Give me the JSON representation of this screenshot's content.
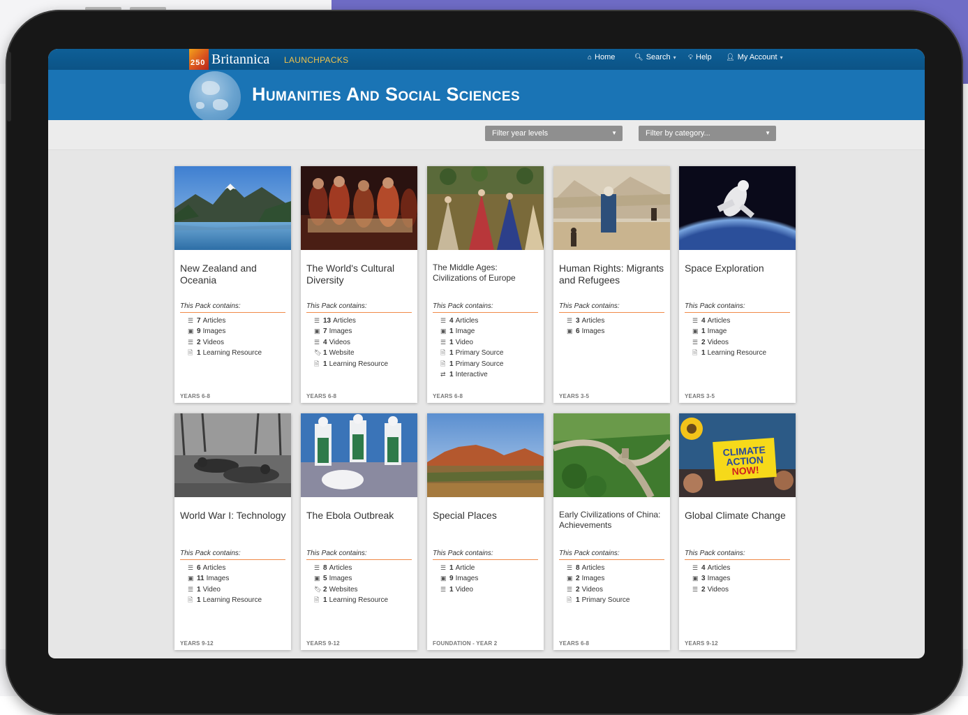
{
  "header": {
    "logo_number": "250",
    "brand": "Britannica",
    "brand_sub": "LAUNCHPACKS",
    "nav": [
      {
        "icon": "home-icon",
        "glyph": "⌂",
        "label": "Home",
        "caret": false
      },
      {
        "icon": "search-icon",
        "glyph": "🔍︎",
        "label": "Search",
        "caret": true
      },
      {
        "icon": "help-icon",
        "glyph": "💡︎",
        "label": "Help",
        "caret": false
      },
      {
        "icon": "user-icon",
        "glyph": "👤︎",
        "label": "My Account",
        "caret": true
      }
    ]
  },
  "banner": {
    "title": "Humanities And Social Sciences"
  },
  "filters": {
    "year_levels": "Filter year levels",
    "category": "Filter by category..."
  },
  "pack_contains_label": "This Pack contains:",
  "cards": [
    {
      "title": "New Zealand and Oceania",
      "years": "YEARS 6-8",
      "items": [
        {
          "type": "articles",
          "count": "7",
          "label": "Articles"
        },
        {
          "type": "images",
          "count": "9",
          "label": "Images"
        },
        {
          "type": "videos",
          "count": "2",
          "label": "Videos"
        },
        {
          "type": "learning",
          "count": "1",
          "label": "Learning Resource"
        }
      ]
    },
    {
      "title": "The World's Cultural Diversity",
      "years": "YEARS 6-8",
      "items": [
        {
          "type": "articles",
          "count": "13",
          "label": "Articles"
        },
        {
          "type": "images",
          "count": "7",
          "label": "Images"
        },
        {
          "type": "videos",
          "count": "4",
          "label": "Videos"
        },
        {
          "type": "website",
          "count": "1",
          "label": "Website"
        },
        {
          "type": "learning",
          "count": "1",
          "label": "Learning Resource"
        }
      ]
    },
    {
      "title": "The Middle Ages: Civilizations of Europe",
      "years": "YEARS 6-8",
      "small": true,
      "items": [
        {
          "type": "articles",
          "count": "4",
          "label": "Articles"
        },
        {
          "type": "images",
          "count": "1",
          "label": "Image"
        },
        {
          "type": "videos",
          "count": "1",
          "label": "Video"
        },
        {
          "type": "primary",
          "count": "1",
          "label": "Primary Source"
        },
        {
          "type": "primary",
          "count": "1",
          "label": "Primary Source"
        },
        {
          "type": "interactive",
          "count": "1",
          "label": "Interactive"
        }
      ]
    },
    {
      "title": "Human Rights: Migrants and Refugees",
      "years": "YEARS 3-5",
      "items": [
        {
          "type": "articles",
          "count": "3",
          "label": "Articles"
        },
        {
          "type": "images",
          "count": "6",
          "label": "Images"
        }
      ]
    },
    {
      "title": "Space Exploration",
      "years": "YEARS 3-5",
      "items": [
        {
          "type": "articles",
          "count": "4",
          "label": "Articles"
        },
        {
          "type": "images",
          "count": "1",
          "label": "Image"
        },
        {
          "type": "videos",
          "count": "2",
          "label": "Videos"
        },
        {
          "type": "learning",
          "count": "1",
          "label": "Learning Resource"
        }
      ]
    },
    {
      "title": "World War I: Technology",
      "years": "YEARS 9-12",
      "items": [
        {
          "type": "articles",
          "count": "6",
          "label": "Articles"
        },
        {
          "type": "images",
          "count": "11",
          "label": "Images"
        },
        {
          "type": "videos",
          "count": "1",
          "label": "Video"
        },
        {
          "type": "learning",
          "count": "1",
          "label": "Learning Resource"
        }
      ]
    },
    {
      "title": "The Ebola Outbreak",
      "years": "YEARS 9-12",
      "items": [
        {
          "type": "articles",
          "count": "8",
          "label": "Articles"
        },
        {
          "type": "images",
          "count": "5",
          "label": "Images"
        },
        {
          "type": "website",
          "count": "2",
          "label": "Websites"
        },
        {
          "type": "learning",
          "count": "1",
          "label": "Learning Resource"
        }
      ]
    },
    {
      "title": "Special Places",
      "years": "FOUNDATION - YEAR 2",
      "items": [
        {
          "type": "articles",
          "count": "1",
          "label": "Article"
        },
        {
          "type": "images",
          "count": "9",
          "label": "Images"
        },
        {
          "type": "videos",
          "count": "1",
          "label": "Video"
        }
      ]
    },
    {
      "title": "Early Civilizations of China: Achievements",
      "years": "YEARS 6-8",
      "small": true,
      "items": [
        {
          "type": "articles",
          "count": "8",
          "label": "Articles"
        },
        {
          "type": "images",
          "count": "2",
          "label": "Images"
        },
        {
          "type": "videos",
          "count": "2",
          "label": "Videos"
        },
        {
          "type": "primary",
          "count": "1",
          "label": "Primary Source"
        }
      ]
    },
    {
      "title": "Global Climate Change",
      "years": "YEARS 9-12",
      "items": [
        {
          "type": "articles",
          "count": "4",
          "label": "Articles"
        },
        {
          "type": "images",
          "count": "3",
          "label": "Images"
        },
        {
          "type": "videos",
          "count": "2",
          "label": "Videos"
        }
      ]
    }
  ],
  "climate_sign": [
    "CLIMATE",
    "ACTION",
    "NOW!"
  ],
  "colors": {
    "topbar": "#0b5386",
    "banner": "#1a74b5",
    "accent_line": "#f08a48",
    "backdrop": "#6f6cc6"
  }
}
